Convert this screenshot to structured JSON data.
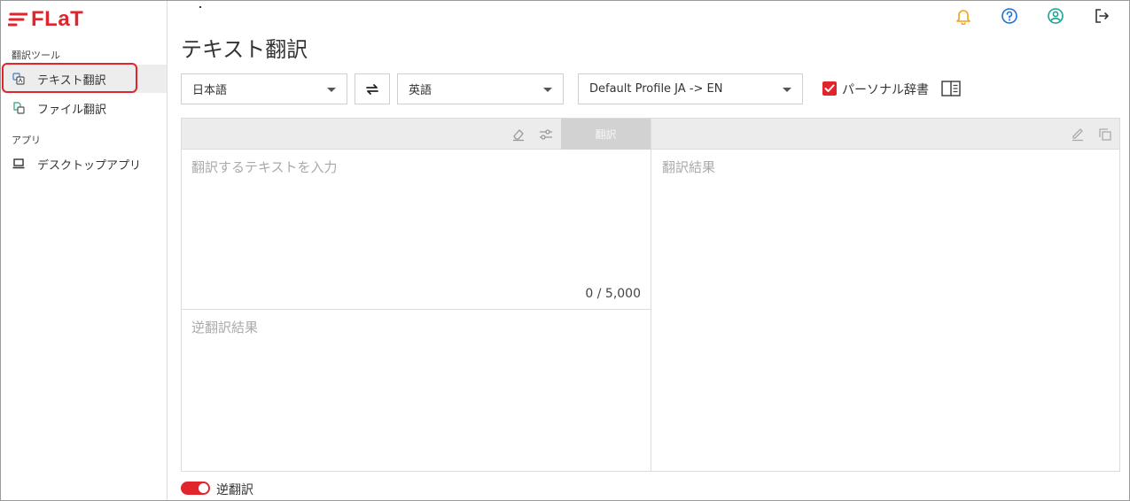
{
  "brand": {
    "logo_text": "FLaT",
    "accent_color": "#e0262c"
  },
  "sidebar": {
    "tools_heading": "翻訳ツール",
    "apps_heading": "アプリ",
    "items": [
      {
        "label": "テキスト翻訳",
        "icon": "text-translate-icon",
        "active": true
      },
      {
        "label": "ファイル翻訳",
        "icon": "file-translate-icon",
        "active": false
      },
      {
        "label": "デスクトップアプリ",
        "icon": "laptop-icon",
        "active": false
      }
    ]
  },
  "header": {
    "icons": [
      "bell-icon",
      "help-icon",
      "account-icon",
      "logout-icon"
    ]
  },
  "page": {
    "title": "テキスト翻訳"
  },
  "controls": {
    "source_language": "日本語",
    "target_language": "英語",
    "profile": "Default Profile JA -> EN",
    "personal_dictionary_label": "パーソナル辞書",
    "personal_dictionary_checked": true
  },
  "editor": {
    "translate_button": "翻訳",
    "source_placeholder": "翻訳するテキストを入力",
    "char_counter": "0 / 5,000",
    "result_placeholder": "翻訳結果",
    "back_translation_placeholder": "逆翻訳結果"
  },
  "footer": {
    "back_translation_toggle_label": "逆翻訳",
    "back_translation_enabled": true
  }
}
